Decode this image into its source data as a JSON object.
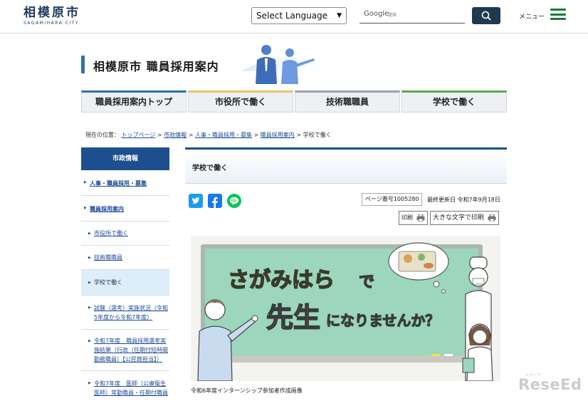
{
  "global_header": {
    "logo_jp": "相模原市",
    "logo_en": "SAGAMIHARA CITY",
    "language_select": "Select Language",
    "search_brand": "Google",
    "search_brand_sub": "提供",
    "menu_label": "メニュー"
  },
  "site_header": {
    "title": "相模原市 職員採用案内"
  },
  "nav_tabs": [
    {
      "label": "職員採用案内トップ"
    },
    {
      "label": "市役所で働く"
    },
    {
      "label": "技術職職員"
    },
    {
      "label": "学校で働く"
    }
  ],
  "breadcrumb": {
    "prefix": "現在の位置：",
    "items": [
      "トップページ",
      "市政情報",
      "人事・職員採用・募集",
      "職員採用案内"
    ],
    "separator": " > ",
    "current": "学校で働く"
  },
  "sidebar": {
    "heading": "市政情報",
    "items": [
      {
        "label": "人事・職員採用・募集"
      },
      {
        "label": "職員採用案内"
      },
      {
        "label": "市役所で働く"
      },
      {
        "label": "技術職職員"
      },
      {
        "label": "学校で働く"
      },
      {
        "label": "試験（選考）実施状況（令和5年度から令和7年度）"
      },
      {
        "label": "令和7年度　職員採用選考実施結果（行政（任期付短時間勤務職員）【公民館担当】）"
      },
      {
        "label": "令和7年度　医師（公衆衛生医師）常勤職員・任期付職員"
      }
    ]
  },
  "main": {
    "page_title": "学校で働く",
    "page_number": "ページ番号1005280",
    "last_updated": "最終更新日 令和7年9月18日",
    "print_label": "印刷",
    "print_large_label": "大きな文字で印刷",
    "banner_text_1": "さがみはら",
    "banner_text_2": "で",
    "banner_text_3": "先生",
    "banner_text_4": "になりませんか？",
    "caption": "令和6年度インターンシップ参加者作成画像"
  },
  "watermark": {
    "text": "ReseEd",
    "sub": "リシード"
  },
  "colors": {
    "primary_navy": "#1d4f8e",
    "accent_green": "#1a7a3a",
    "link_blue": "#1c4b99"
  }
}
